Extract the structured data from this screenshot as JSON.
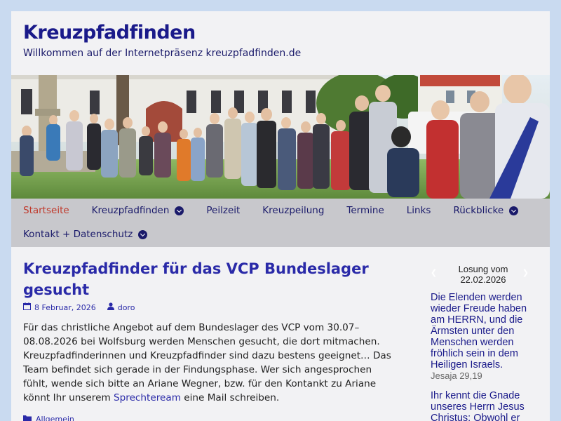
{
  "site": {
    "title": "Kreuzpfadfinden",
    "description": "Willkommen auf der Internetpräsenz kreuzpfadfinden.de"
  },
  "colors": {
    "background": "#c9daf0",
    "title": "#1a1a8a",
    "link": "#2a2aa8",
    "nav_bg": "#c8c8cc",
    "nav_active": "#c0392b"
  },
  "nav": {
    "row1": [
      {
        "label": "Startseite",
        "active": true,
        "dropdown": false
      },
      {
        "label": "Kreuzpfadfinden",
        "active": false,
        "dropdown": true
      },
      {
        "label": "Peilzeit",
        "active": false,
        "dropdown": false
      },
      {
        "label": "Kreuzpeilung",
        "active": false,
        "dropdown": false
      },
      {
        "label": "Termine",
        "active": false,
        "dropdown": false
      },
      {
        "label": "Links",
        "active": false,
        "dropdown": false
      },
      {
        "label": "Rückblicke",
        "active": false,
        "dropdown": true
      }
    ],
    "row2": [
      {
        "label": "Kontakt + Datenschutz",
        "active": false,
        "dropdown": true
      }
    ]
  },
  "post": {
    "title": "Kreuzpfadfinder für das VCP Bundeslager gesucht",
    "date": "8 Februar, 2026",
    "author": "doro",
    "body_before_link": "Für das christliche Angebot auf dem Bundeslager des VCP vom 30.07–08.08.2026 bei Wolfsburg werden Menschen gesucht, die dort mitmachen. Kreuzpfadfinderinnen und Kreuzpfadfinder sind dazu bestens geeignet… Das Team befindet sich gerade in der Findungsphase. Wer sich angesprochen fühlt, wende sich bitte an Ariane Wegner, bzw. für den Kontankt zu Ariane könnt Ihr unserem ",
    "link_text": "Sprechteream",
    "body_after_link": " eine Mail schreiben.",
    "category": "Allgemein"
  },
  "sidebar": {
    "losung_label": "Losung vom",
    "losung_date": "22.02.2026",
    "verse1": "Die Elenden werden wieder Freude haben am HERRN, und die Ärmsten unter den Menschen werden fröhlich sein in dem Heiligen Israels.",
    "verse1_ref": "Jesaja 29,19",
    "verse2": "Ihr kennt die Gnade unseres Herrn Jesus Christus: Obwohl er"
  },
  "icons": {
    "date": "calendar-icon",
    "author": "user-icon",
    "category": "folder-icon",
    "dropdown": "chevron-down-circle-icon",
    "losung_prev": "arrow-left-icon",
    "losung_next": "arrow-right-icon"
  }
}
